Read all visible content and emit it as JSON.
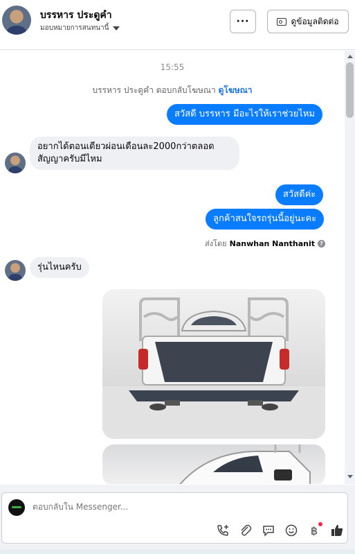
{
  "header": {
    "name": "บรรหาร ประดูคำ",
    "assign_label": "มอบหมายการสนทนานี้",
    "more_label": "···",
    "contact_label": "ดูข้อมูลติดต่อ"
  },
  "thread": {
    "timestamp": "15:55",
    "replied_text": "บรรหาร ประดูคำ ตอบกลับโฆษณา",
    "ad_link": "ดูโฆษณา",
    "messages": [
      {
        "dir": "out",
        "text": "สวัสดี บรรหาร มีอะไรให้เราช่วยไหม"
      },
      {
        "dir": "in",
        "text": "อยากได้ตอนเดียวผ่อนเดือนละ2000กว่าตลอดสัญญาครับมีไหม"
      },
      {
        "dir": "out",
        "text": "สวัสดีค่ะ"
      },
      {
        "dir": "out",
        "text": "ลูกค้าสนใจรถรุ่นนี้อยู่นะคะ"
      },
      {
        "dir": "in",
        "text": "รุ่นไหนครับ"
      }
    ],
    "sent_by_prefix": "ส่งโดย",
    "sent_by_name": "Nanwhan Nanthanit"
  },
  "composer": {
    "placeholder": "ตอบกลับใน Messenger..."
  },
  "icons": {
    "call": "phone-plus-icon",
    "attach": "paperclip-icon",
    "saved_reply": "chat-bubble-icon",
    "emoji": "smiley-icon",
    "payment": "baht-icon",
    "like": "thumbs-up-icon"
  },
  "colors": {
    "accent": "#0a7cff",
    "incoming": "#eef0f3",
    "link": "#1a73e8"
  }
}
